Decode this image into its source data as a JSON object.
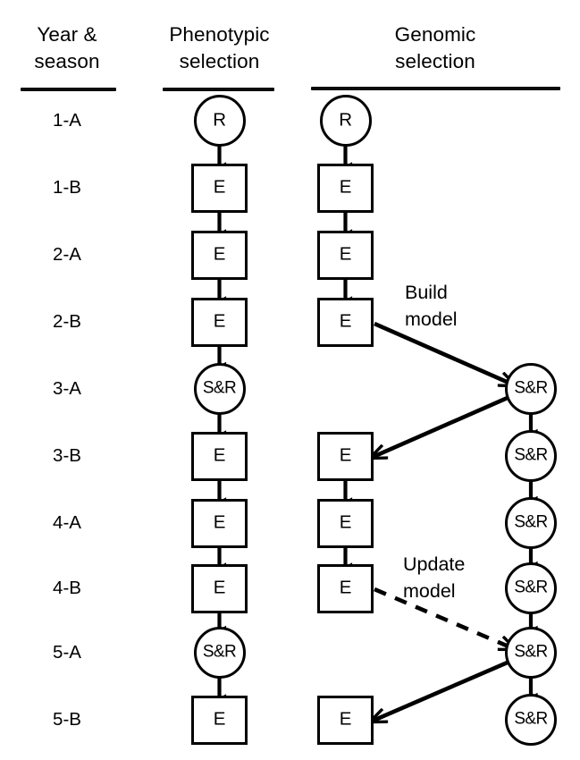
{
  "headers": [
    {
      "id": "year-season",
      "text": "Year &\nseason"
    },
    {
      "id": "phenotypic",
      "text": "Phenotypic\nselection"
    },
    {
      "id": "genomic",
      "text": "Genomic\nselection"
    }
  ],
  "row_labels": [
    "1-A",
    "1-B",
    "2-A",
    "2-B",
    "3-A",
    "3-B",
    "4-A",
    "4-B",
    "5-A",
    "5-B"
  ],
  "phenotypic_nodes": [
    {
      "row": "1-A",
      "shape": "circle",
      "label": "R"
    },
    {
      "row": "1-B",
      "shape": "square",
      "label": "E"
    },
    {
      "row": "2-A",
      "shape": "square",
      "label": "E"
    },
    {
      "row": "2-B",
      "shape": "square",
      "label": "E"
    },
    {
      "row": "3-A",
      "shape": "circle",
      "label": "S&R"
    },
    {
      "row": "3-B",
      "shape": "square",
      "label": "E"
    },
    {
      "row": "4-A",
      "shape": "square",
      "label": "E"
    },
    {
      "row": "4-B",
      "shape": "square",
      "label": "E"
    },
    {
      "row": "5-A",
      "shape": "circle",
      "label": "S&R"
    },
    {
      "row": "5-B",
      "shape": "square",
      "label": "E"
    }
  ],
  "genomic_field_nodes": [
    {
      "row": "1-A",
      "shape": "circle",
      "label": "R"
    },
    {
      "row": "1-B",
      "shape": "square",
      "label": "E"
    },
    {
      "row": "2-A",
      "shape": "square",
      "label": "E"
    },
    {
      "row": "2-B",
      "shape": "square",
      "label": "E"
    },
    {
      "row": "3-B",
      "shape": "square",
      "label": "E"
    },
    {
      "row": "4-A",
      "shape": "square",
      "label": "E"
    },
    {
      "row": "4-B",
      "shape": "square",
      "label": "E"
    },
    {
      "row": "5-B",
      "shape": "square",
      "label": "E"
    }
  ],
  "genomic_model_nodes": [
    {
      "row": "3-A",
      "shape": "circle",
      "label": "S&R"
    },
    {
      "row": "3-B",
      "shape": "circle",
      "label": "S&R"
    },
    {
      "row": "4-A",
      "shape": "circle",
      "label": "S&R"
    },
    {
      "row": "4-B",
      "shape": "circle",
      "label": "S&R"
    },
    {
      "row": "5-A",
      "shape": "circle",
      "label": "S&R"
    },
    {
      "row": "5-B",
      "shape": "circle",
      "label": "S&R"
    }
  ],
  "annotations": [
    {
      "id": "build-model",
      "text": "Build\nmodel"
    },
    {
      "id": "update-model",
      "text": "Update\nmodel"
    }
  ],
  "colors": {
    "stroke": "#000000",
    "background": "#ffffff",
    "rule": "#0b0b0b"
  },
  "legend_note": {
    "R": "R",
    "E": "E",
    "SR": "S&R"
  }
}
